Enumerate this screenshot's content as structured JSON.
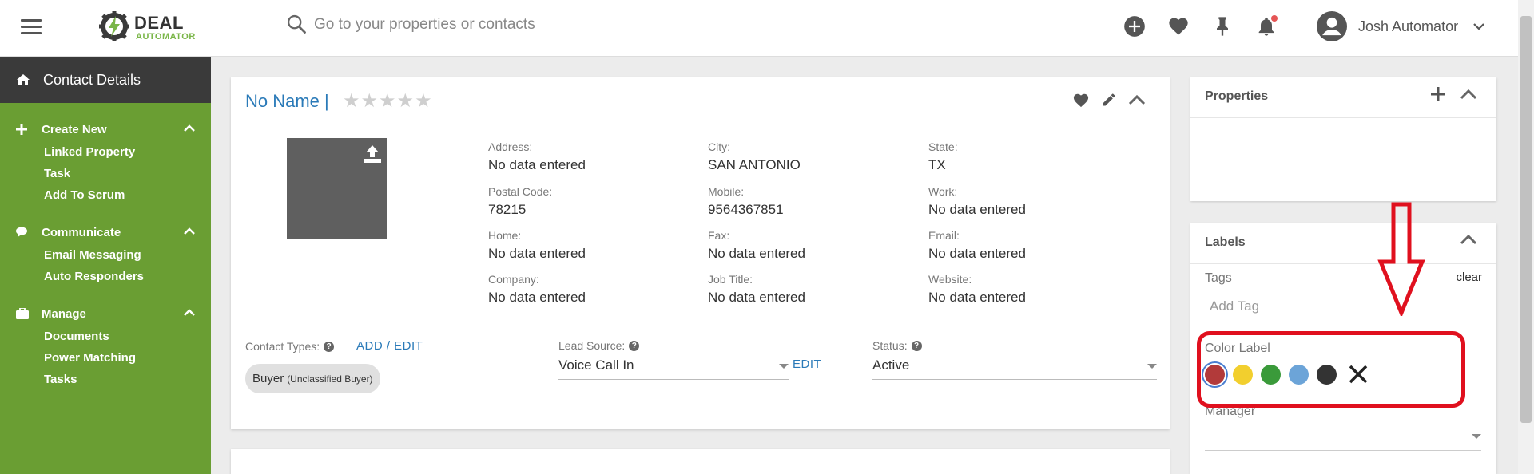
{
  "topbar": {
    "logo_word": "DEAL",
    "logo_sub": "AUTOMATOR",
    "search_placeholder": "Go to your properties or contacts",
    "user_name": "Josh Automator",
    "colors": {
      "notification_dot": "#e55555"
    }
  },
  "sidebar": {
    "title": "Contact Details",
    "sections": [
      {
        "title": "Create New",
        "icon": "plus-icon",
        "items": [
          "Linked Property",
          "Task",
          "Add To Scrum"
        ]
      },
      {
        "title": "Communicate",
        "icon": "chat-icon",
        "items": [
          "Email Messaging",
          "Auto Responders"
        ]
      },
      {
        "title": "Manage",
        "icon": "briefcase-icon",
        "items": [
          "Documents",
          "Power Matching",
          "Tasks"
        ]
      }
    ],
    "colors": {
      "background": "#6a9e33",
      "header": "#3a3a3a"
    }
  },
  "contact": {
    "name": "No Name |",
    "rating": 0,
    "max_rating": 5,
    "fields": {
      "address": {
        "label": "Address:",
        "value": "No data entered"
      },
      "city": {
        "label": "City:",
        "value": "SAN ANTONIO"
      },
      "state": {
        "label": "State:",
        "value": "TX"
      },
      "postal": {
        "label": "Postal Code:",
        "value": "78215"
      },
      "mobile": {
        "label": "Mobile:",
        "value": "9564367851"
      },
      "work": {
        "label": "Work:",
        "value": "No data entered"
      },
      "home": {
        "label": "Home:",
        "value": "No data entered"
      },
      "fax": {
        "label": "Fax:",
        "value": "No data entered"
      },
      "email": {
        "label": "Email:",
        "value": "No data entered"
      },
      "company": {
        "label": "Company:",
        "value": "No data entered"
      },
      "job_title": {
        "label": "Job Title:",
        "value": "No data entered"
      },
      "website": {
        "label": "Website:",
        "value": "No data entered"
      }
    },
    "contact_types_label": "Contact Types:",
    "add_edit": "ADD / EDIT",
    "chip_main": "Buyer",
    "chip_sub": "(Unclassified Buyer)",
    "lead_source_label": "Lead Source:",
    "lead_source_value": "Voice Call In",
    "lead_edit": "EDIT",
    "status_label": "Status:",
    "status_value": "Active",
    "help_glyph": "?"
  },
  "properties": {
    "title": "Properties"
  },
  "labels": {
    "title": "Labels",
    "tags_label": "Tags",
    "clear": "clear",
    "tag_placeholder": "Add Tag",
    "color_label": "Color Label",
    "colors": [
      "#b23a3a",
      "#f2cf2e",
      "#3a9a3a",
      "#6ca4d8",
      "#333333"
    ],
    "selected_color_index": 0,
    "manager_label": "Manager"
  },
  "annotation": {
    "color": "#e0101e"
  }
}
